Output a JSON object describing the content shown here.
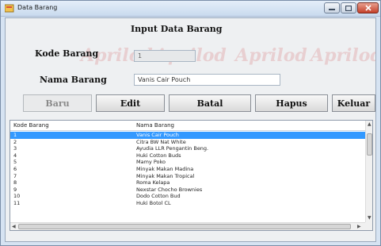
{
  "window": {
    "title": "Data Barang"
  },
  "form": {
    "heading": "Input Data Barang",
    "kode_label": "Kode Barang",
    "kode_value": "1",
    "nama_label": "Nama Barang",
    "nama_value": "Vanis Cair Pouch",
    "watermark_text": "Aprilod"
  },
  "buttons": {
    "baru": "Baru",
    "edit": "Edit",
    "batal": "Batal",
    "hapus": "Hapus",
    "keluar": "Keluar"
  },
  "grid": {
    "columns": [
      "Kode Barang",
      "Nama Barang"
    ],
    "rows": [
      [
        "1",
        "Vanis Cair Pouch"
      ],
      [
        "2",
        "Citra BW Nat White"
      ],
      [
        "3",
        "Ayudia LLR Pengantin Beng."
      ],
      [
        "4",
        "Huki Cotton Buds"
      ],
      [
        "5",
        "Mamy Poko"
      ],
      [
        "6",
        "Minyak Makan Madina"
      ],
      [
        "7",
        "Minyak Makan Tropical"
      ],
      [
        "8",
        "Roma Kelapa"
      ],
      [
        "9",
        "Nexstar Chocho Brownies"
      ],
      [
        "10",
        "Dodo Cotton Bud"
      ],
      [
        "11",
        "Huki Botol CL"
      ]
    ],
    "selected_row": 0
  },
  "colors": {
    "selection": "#3399ff",
    "watermark": "#cd3c3c"
  }
}
